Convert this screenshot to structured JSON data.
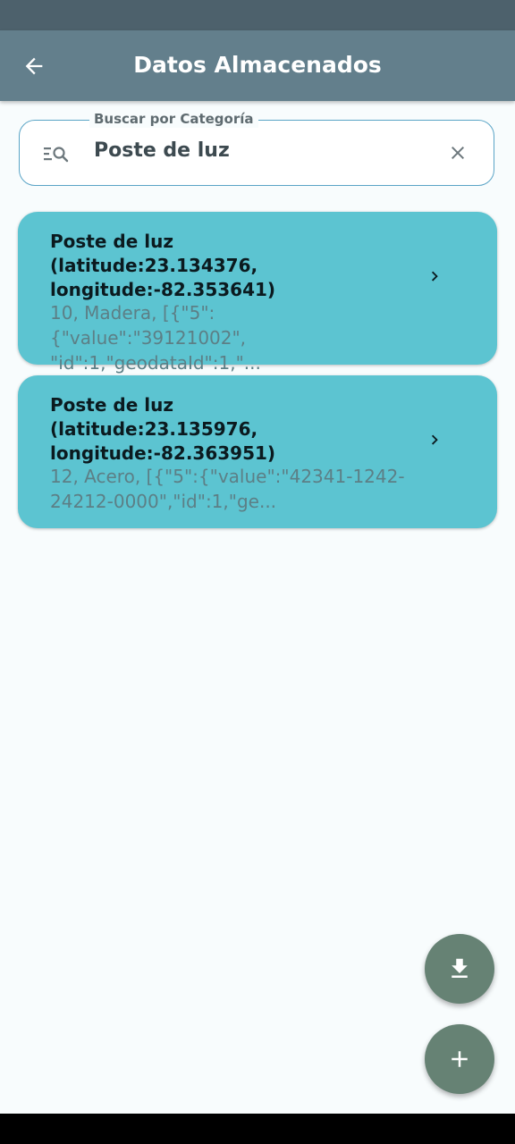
{
  "app_bar": {
    "title": "Datos Almacenados",
    "back_icon": "arrow-left-icon"
  },
  "search": {
    "label": "Buscar por Categoría",
    "value": "Poste de luz",
    "leading_icon": "search-list-icon",
    "clear_icon": "close-icon"
  },
  "records": [
    {
      "title": "Poste de luz\n(latitude:23.134376,\nlongitude:-82.353641)",
      "subtitle": "10, Madera, [{\"5\":{\"value\":\"39121002\",\n\"id\":1,\"geodataId\":1,\"..."
    },
    {
      "title": "Poste de luz\n(latitude:23.135976,\nlongitude:-82.363951)",
      "subtitle": "12, Acero, [{\"5\":{\"value\":\"42341-1242-\n24212-0000\",\"id\":1,\"ge..."
    }
  ],
  "fabs": {
    "download_icon": "download-icon",
    "add_icon": "plus-icon"
  },
  "colors": {
    "app_bar": "#637f8c",
    "status_bar": "#4d616c",
    "card": "#5cc4d1",
    "fab": "#668274",
    "search_border": "#5aa4c6"
  }
}
